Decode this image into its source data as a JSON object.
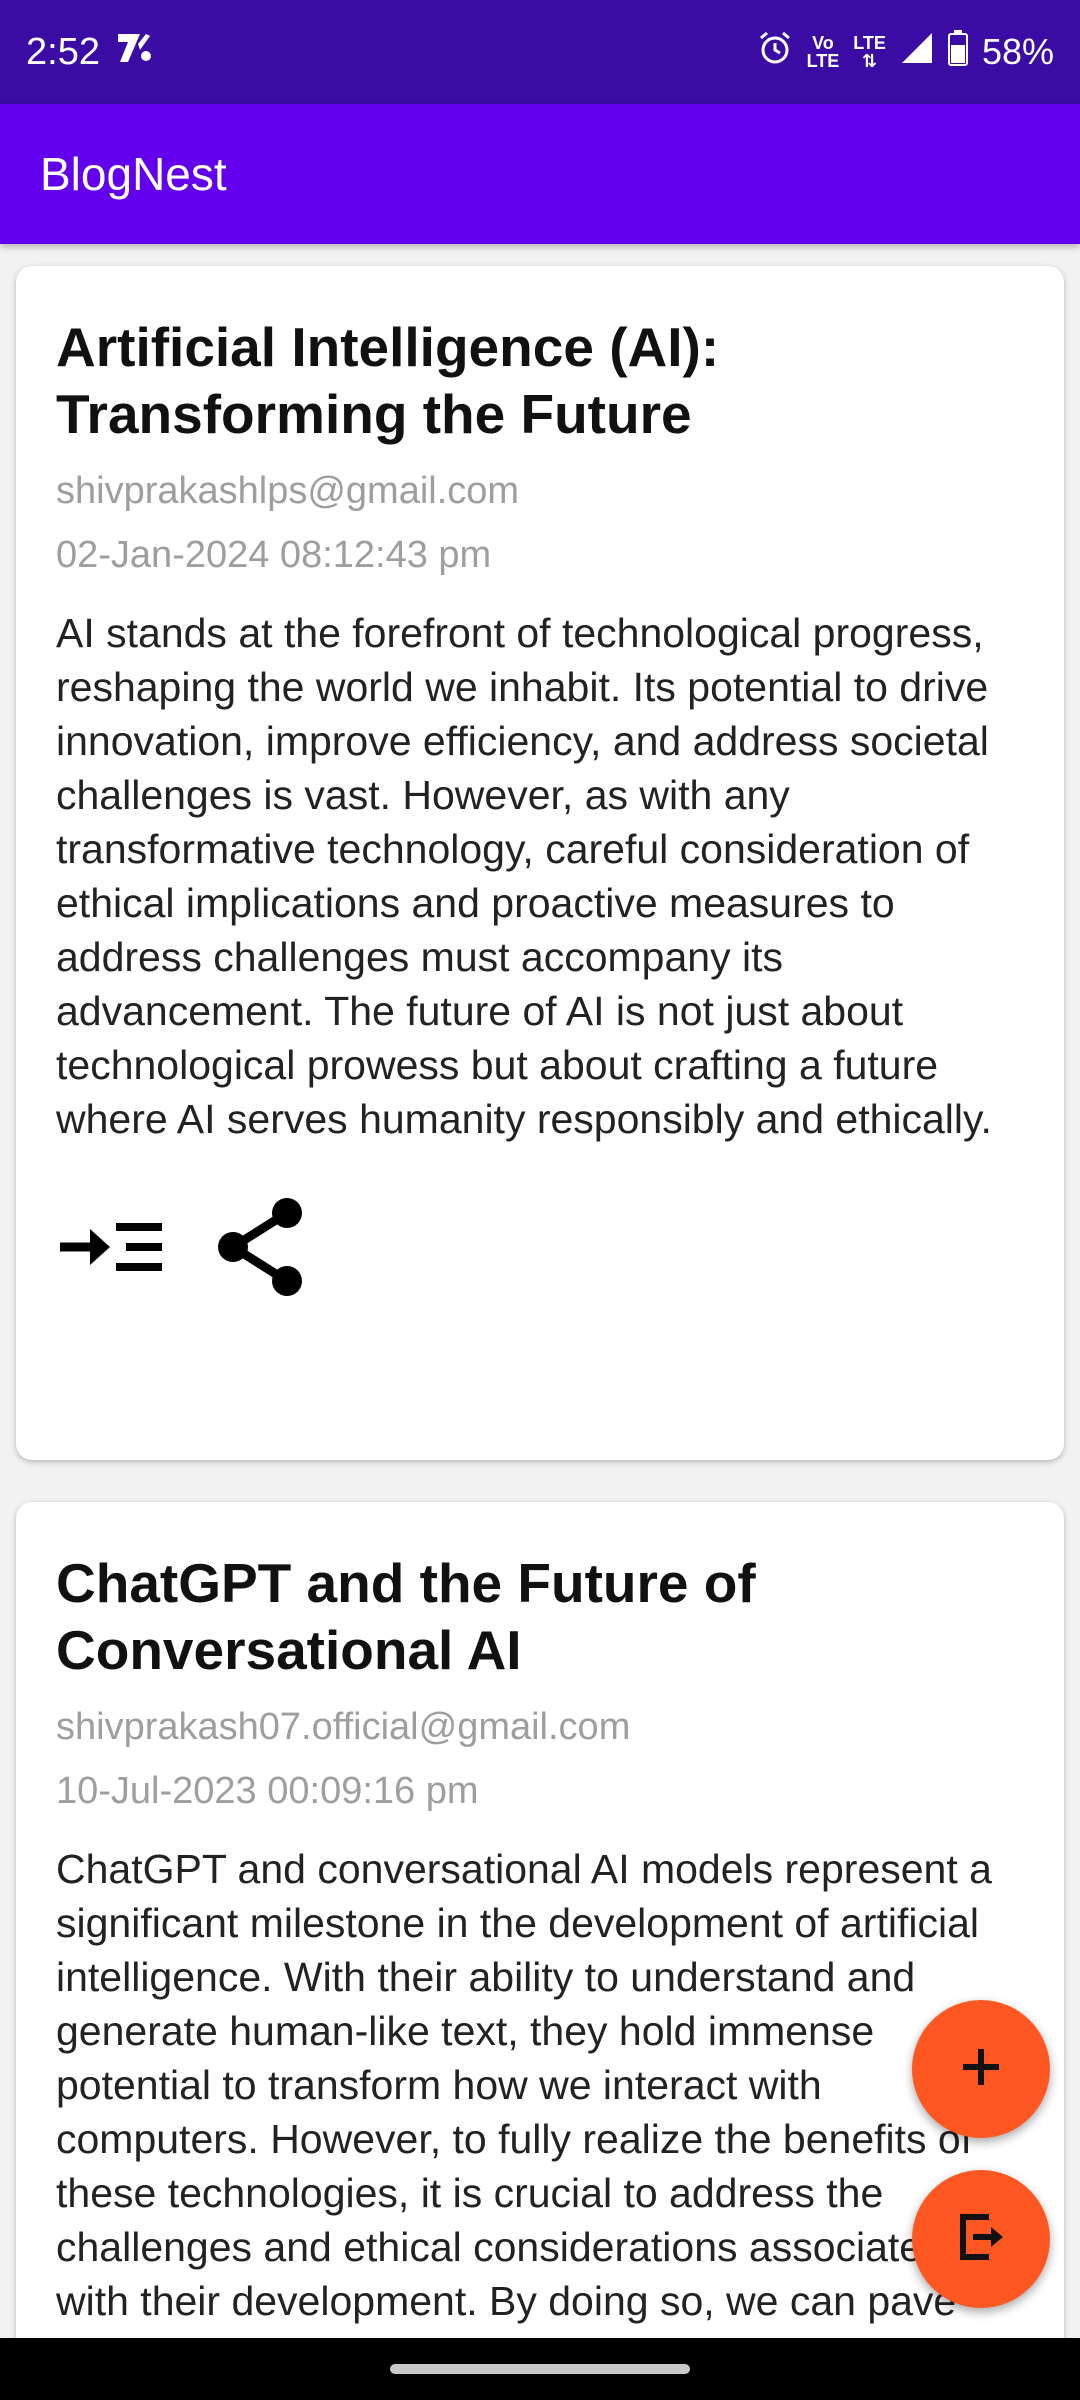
{
  "status_bar": {
    "time": "2:52",
    "battery": "58%",
    "network_top": "LTE",
    "volte_top": "Vo",
    "volte_bottom": "LTE"
  },
  "app_bar": {
    "title": "BlogNest"
  },
  "posts": [
    {
      "title": "Artificial Intelligence (AI): Transforming the Future",
      "author": "shivprakashlps@gmail.com",
      "date": "02-Jan-2024 08:12:43 pm",
      "body": "AI stands at the forefront of technological progress, reshaping the world we inhabit. Its potential to drive innovation, improve efficiency, and address societal challenges is vast. However, as with any transformative technology, careful consideration of ethical implications and proactive measures to address challenges must accompany its advancement. The future of AI is not just about technological prowess but about crafting a future where AI serves humanity responsibly and ethically."
    },
    {
      "title": "ChatGPT and the Future of Conversational AI",
      "author": "shivprakash07.official@gmail.com",
      "date": "10-Jul-2023 00:09:16 pm",
      "body": "ChatGPT and conversational AI models represent a significant milestone in the development of artificial intelligence. With their ability to understand and generate human-like text, they hold immense potential to transform how we interact with computers. However, to fully realize the benefits of these technologies, it is crucial to address the challenges and ethical considerations associated with their development. By doing so, we can pave the way for"
    }
  ],
  "icons": {
    "read_more": "read-more-icon",
    "share": "share-icon",
    "add": "add-icon",
    "logout": "logout-icon"
  },
  "colors": {
    "status_bar": "#3a0ca3",
    "app_bar": "#6200ee",
    "fab": "#ff5722"
  }
}
